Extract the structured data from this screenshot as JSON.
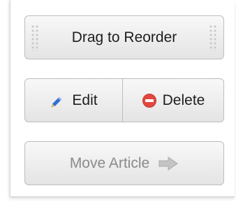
{
  "buttons": {
    "drag": {
      "label": "Drag to Reorder",
      "icon": "grip-dots-icon"
    },
    "edit": {
      "label": "Edit",
      "icon": "pencil-icon"
    },
    "delete": {
      "label": "Delete",
      "icon": "minus-circle-icon"
    },
    "move": {
      "label": "Move Article",
      "icon": "arrow-right-icon",
      "state": "disabled"
    }
  },
  "colors": {
    "pencil_body": "#2f6fd6",
    "pencil_tip": "#f2c14e",
    "delete_red": "#e2473f",
    "disabled_text": "#8a8a8a",
    "arrow_gray": "#b9b9b9"
  }
}
